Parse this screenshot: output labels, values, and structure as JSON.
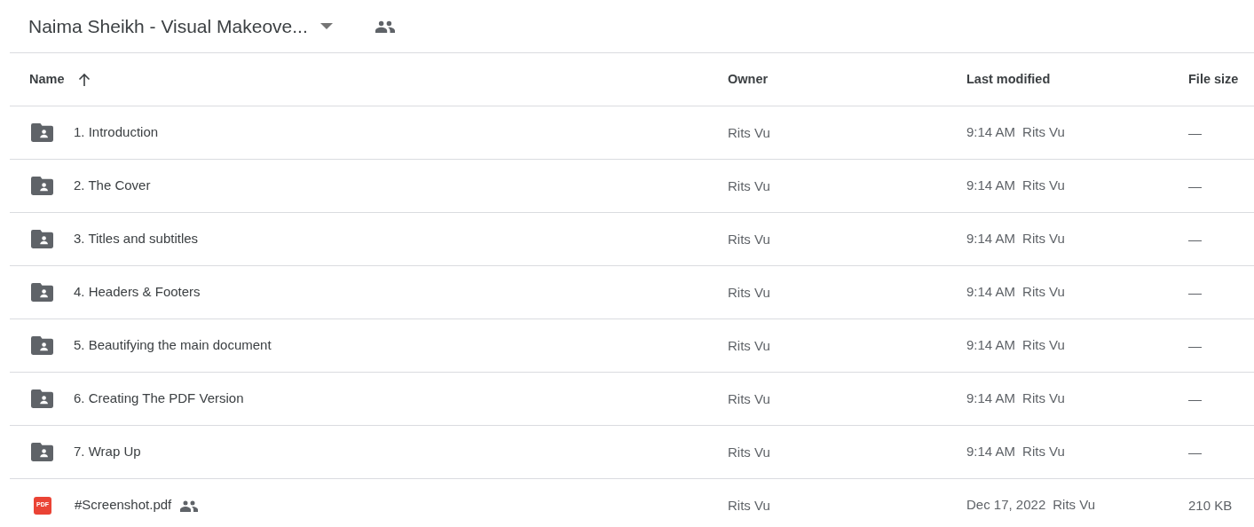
{
  "folder": {
    "title": "Naima Sheikh - Visual Makeove...",
    "shared": true
  },
  "table": {
    "columns": [
      {
        "label": "Name",
        "sorted": true
      },
      {
        "label": "Owner",
        "sorted": false
      },
      {
        "label": "Last modified",
        "sorted": false
      },
      {
        "label": "File size",
        "sorted": false
      }
    ],
    "rows": [
      {
        "kind": "folder",
        "name": "1. Introduction",
        "shared": false,
        "owner": "Rits Vu",
        "modified": "9:14 AM",
        "modified_by": "Rits Vu",
        "size": "—"
      },
      {
        "kind": "folder",
        "name": "2. The Cover",
        "shared": false,
        "owner": "Rits Vu",
        "modified": "9:14 AM",
        "modified_by": "Rits Vu",
        "size": "—"
      },
      {
        "kind": "folder",
        "name": "3. Titles and subtitles",
        "shared": false,
        "owner": "Rits Vu",
        "modified": "9:14 AM",
        "modified_by": "Rits Vu",
        "size": "—"
      },
      {
        "kind": "folder",
        "name": "4. Headers & Footers",
        "shared": false,
        "owner": "Rits Vu",
        "modified": "9:14 AM",
        "modified_by": "Rits Vu",
        "size": "—"
      },
      {
        "kind": "folder",
        "name": "5. Beautifying the main document",
        "shared": false,
        "owner": "Rits Vu",
        "modified": "9:14 AM",
        "modified_by": "Rits Vu",
        "size": "—"
      },
      {
        "kind": "folder",
        "name": "6. Creating The PDF Version",
        "shared": false,
        "owner": "Rits Vu",
        "modified": "9:14 AM",
        "modified_by": "Rits Vu",
        "size": "—"
      },
      {
        "kind": "folder",
        "name": "7. Wrap Up",
        "shared": false,
        "owner": "Rits Vu",
        "modified": "9:14 AM",
        "modified_by": "Rits Vu",
        "size": "—"
      },
      {
        "kind": "pdf",
        "icon_label": "PDF",
        "name": "#Screenshot.pdf",
        "shared": true,
        "owner": "Rits Vu",
        "modified": "Dec 17, 2022",
        "modified_by": "Rits Vu",
        "size": "210 KB"
      }
    ]
  }
}
